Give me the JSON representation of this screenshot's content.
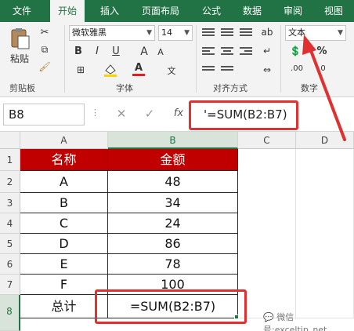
{
  "menu": {
    "tabs": [
      "文件",
      "开始",
      "插入",
      "页面布局",
      "公式",
      "数据",
      "审阅",
      "视图"
    ]
  },
  "ribbon": {
    "paste_label": "粘贴",
    "font_name": "微软雅黑",
    "font_size": "14",
    "number_format": "文本",
    "groups": {
      "clipboard": "剪贴板",
      "font": "字体",
      "alignment": "对齐方式",
      "number": "数字"
    },
    "buttons": {
      "bold": "B",
      "italic": "I",
      "underline": "U",
      "font_color": "A",
      "grow_font": "A",
      "shrink_font": "A",
      "percent": "%"
    }
  },
  "formula_bar": {
    "name_box": "B8",
    "cancel": "✕",
    "enter": "✓",
    "fx": "fx",
    "content": "'=SUM(B2:B7)"
  },
  "columns": [
    "A",
    "B",
    "C",
    "D"
  ],
  "rows": [
    "1",
    "2",
    "3",
    "4",
    "5",
    "6",
    "7",
    "8"
  ],
  "table": {
    "headers": [
      "名称",
      "金额"
    ],
    "rows": [
      [
        "A",
        "48"
      ],
      [
        "B",
        "34"
      ],
      [
        "C",
        "24"
      ],
      [
        "D",
        "86"
      ],
      [
        "E",
        "78"
      ],
      [
        "F",
        "100"
      ]
    ],
    "total_label": "总计",
    "total_value": "=SUM(B2:B7)"
  },
  "watermark": "微信号:exceltip_net",
  "colors": {
    "excel_green": "#217346",
    "header_red": "#c00000",
    "annotation_red": "#e03030"
  }
}
